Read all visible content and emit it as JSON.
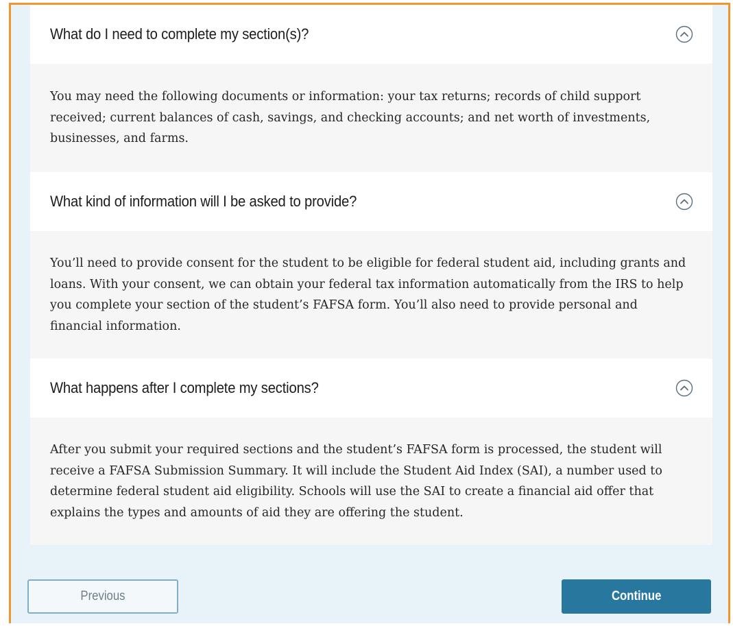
{
  "faq": [
    {
      "question": "What do I need to complete my section(s)?",
      "answer": "You may need the following documents or information: your tax returns; records of child support received; current balances of cash, savings, and checking accounts; and net worth of investments, businesses, and farms.",
      "expanded": true
    },
    {
      "question": "What kind of information will I be asked to provide?",
      "answer": "You’ll need to provide consent for the student to be eligible for federal student aid, including grants and loans. With your consent, we can obtain your federal tax information automatically from the IRS to help you complete your section of the student’s FAFSA form. You’ll also need to provide personal and financial information.",
      "expanded": true
    },
    {
      "question": "What happens after I complete my sections?",
      "answer": "After you submit your required sections and the student’s FAFSA form is processed, the student will receive a FAFSA Submission Summary. It will include the Student Aid Index (SAI), a number used to determine federal student aid eligibility. Schools will use the SAI to create a financial aid offer that explains the types and amounts of aid they are offering the student.",
      "expanded": true
    }
  ],
  "nav": {
    "previous_label": "Previous",
    "continue_label": "Continue"
  },
  "icons": {
    "collapse": "chevron-up-circle-icon"
  },
  "colors": {
    "highlight_border": "#f0962f",
    "page_background": "#e7f2f9",
    "primary_button": "#27779e",
    "secondary_button_border": "#7faecb"
  }
}
